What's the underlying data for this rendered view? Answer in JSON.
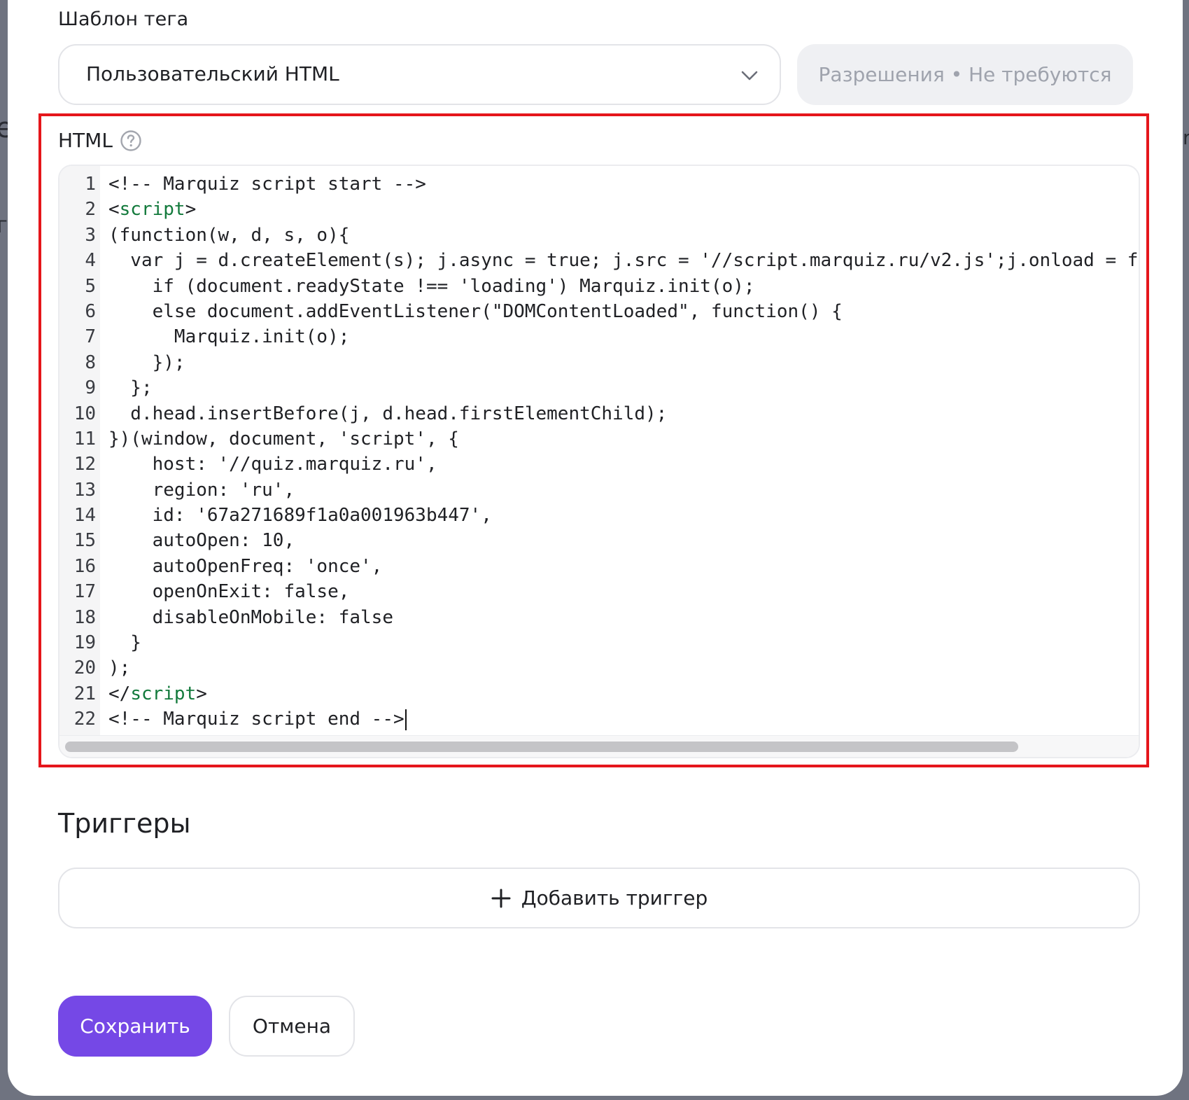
{
  "form": {
    "template_label": "Шаблон тега",
    "template_value": "Пользовательский HTML",
    "permissions_label": "Разрешения • Не требуются",
    "html_label": "HTML"
  },
  "editor": {
    "lines": [
      {
        "num": "1",
        "segments": [
          {
            "text": "<!-- Marquiz script start -->",
            "type": "plain"
          }
        ]
      },
      {
        "num": "2",
        "segments": [
          {
            "text": "<",
            "type": "plain"
          },
          {
            "text": "script",
            "type": "tag"
          },
          {
            "text": ">",
            "type": "plain"
          }
        ]
      },
      {
        "num": "3",
        "segments": [
          {
            "text": "(function(w, d, s, o){",
            "type": "plain"
          }
        ]
      },
      {
        "num": "4",
        "segments": [
          {
            "text": "  var j = d.createElement(s); j.async = true; j.src = '//script.marquiz.ru/v2.js';j.onload = f",
            "type": "plain"
          }
        ]
      },
      {
        "num": "5",
        "segments": [
          {
            "text": "    if (document.readyState !== 'loading') Marquiz.init(o);",
            "type": "plain"
          }
        ]
      },
      {
        "num": "6",
        "segments": [
          {
            "text": "    else document.addEventListener(\"DOMContentLoaded\", function() {",
            "type": "plain"
          }
        ]
      },
      {
        "num": "7",
        "segments": [
          {
            "text": "      Marquiz.init(o);",
            "type": "plain"
          }
        ]
      },
      {
        "num": "8",
        "segments": [
          {
            "text": "    });",
            "type": "plain"
          }
        ]
      },
      {
        "num": "9",
        "segments": [
          {
            "text": "  };",
            "type": "plain"
          }
        ]
      },
      {
        "num": "10",
        "segments": [
          {
            "text": "  d.head.insertBefore(j, d.head.firstElementChild);",
            "type": "plain"
          }
        ]
      },
      {
        "num": "11",
        "segments": [
          {
            "text": "})(window, document, 'script', {",
            "type": "plain"
          }
        ]
      },
      {
        "num": "12",
        "segments": [
          {
            "text": "    host: '//quiz.marquiz.ru',",
            "type": "plain"
          }
        ]
      },
      {
        "num": "13",
        "segments": [
          {
            "text": "    region: 'ru',",
            "type": "plain"
          }
        ]
      },
      {
        "num": "14",
        "segments": [
          {
            "text": "    id: '67a271689f1a0a001963b447',",
            "type": "plain"
          }
        ]
      },
      {
        "num": "15",
        "segments": [
          {
            "text": "    autoOpen: 10,",
            "type": "plain"
          }
        ]
      },
      {
        "num": "16",
        "segments": [
          {
            "text": "    autoOpenFreq: 'once',",
            "type": "plain"
          }
        ]
      },
      {
        "num": "17",
        "segments": [
          {
            "text": "    openOnExit: false,",
            "type": "plain"
          }
        ]
      },
      {
        "num": "18",
        "segments": [
          {
            "text": "    disableOnMobile: false",
            "type": "plain"
          }
        ]
      },
      {
        "num": "19",
        "segments": [
          {
            "text": "  }",
            "type": "plain"
          }
        ]
      },
      {
        "num": "20",
        "segments": [
          {
            "text": ");",
            "type": "plain"
          }
        ]
      },
      {
        "num": "21",
        "segments": [
          {
            "text": "</",
            "type": "plain"
          },
          {
            "text": "script",
            "type": "tag"
          },
          {
            "text": ">",
            "type": "plain"
          }
        ]
      },
      {
        "num": "22",
        "segments": [
          {
            "text": "<!-- Marquiz script end -->",
            "type": "plain"
          }
        ]
      }
    ]
  },
  "triggers": {
    "title": "Триггеры",
    "add_label": "Добавить триггер"
  },
  "actions": {
    "save_label": "Сохранить",
    "cancel_label": "Отмена"
  },
  "icons": {
    "select_chevron": "chevron-down-icon",
    "help": "question-circle-icon",
    "add": "plus-icon"
  },
  "colors": {
    "accent": "#7548e6",
    "highlight_border": "#e5161b",
    "syntax_tag": "#137a3c"
  }
}
